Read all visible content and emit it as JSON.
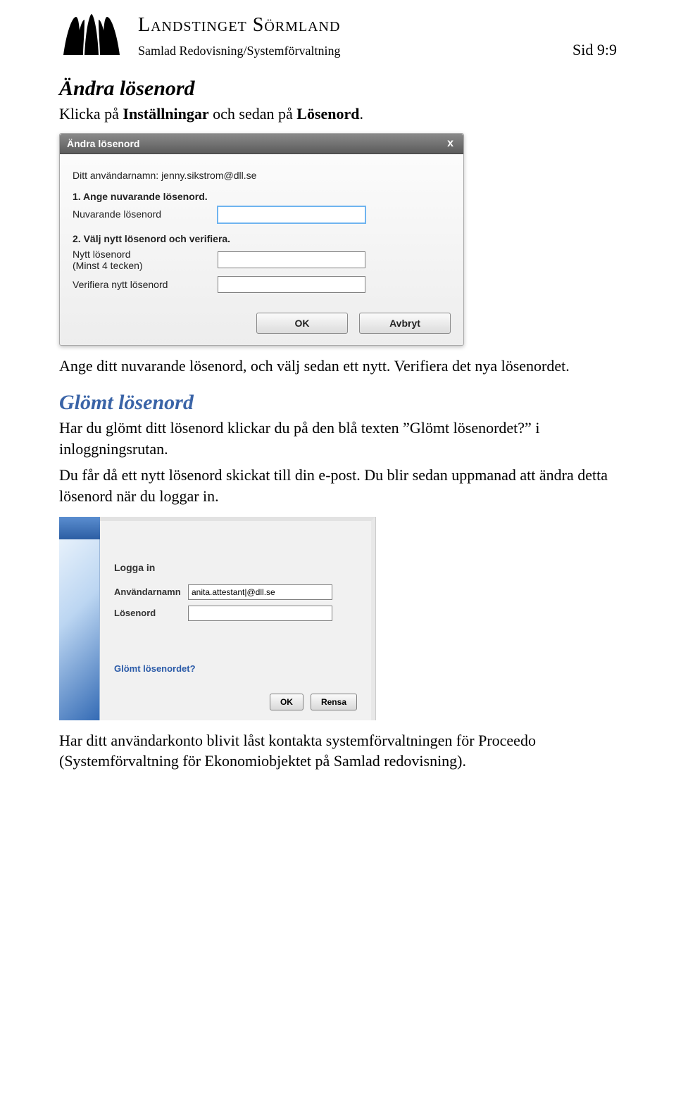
{
  "header": {
    "org_name": "Landstinget Sörmland",
    "subtitle": "Samlad Redovisning/Systemförvaltning",
    "page_indicator": "Sid 9:9"
  },
  "section1": {
    "heading": "Ändra lösenord",
    "intro_a": "Klicka på ",
    "intro_b1": "Inställningar",
    "intro_mid": " och sedan på ",
    "intro_b2": "Lösenord",
    "intro_end": "."
  },
  "dialog": {
    "title": "Ändra lösenord",
    "close": "x",
    "username_line": "Ditt användarnamn: jenny.sikstrom@dll.se",
    "step1": "1. Ange nuvarande lösenord.",
    "current_pw_label": "Nuvarande lösenord",
    "step2": "2. Välj nytt lösenord och verifiera.",
    "new_pw_label_l1": "Nytt lösenord",
    "new_pw_label_l2": "(Minst 4 tecken)",
    "verify_pw_label": "Verifiera nytt lösenord",
    "ok": "OK",
    "cancel": "Avbryt"
  },
  "after_dialog": "Ange ditt nuvarande lösenord, och välj sedan ett nytt. Verifiera det nya lösenordet.",
  "section2": {
    "heading": "Glömt lösenord",
    "p1": "Har du glömt ditt lösenord klickar du på den blå texten ”Glömt lösenordet?” i inloggningsrutan.",
    "p2": "Du får då ett nytt lösenord skickat till din e-post. Du blir sedan uppmanad att ändra detta lösenord när du loggar in."
  },
  "login": {
    "heading": "Logga in",
    "user_label": "Användarnamn",
    "user_value": "anita.attestant|@dll.se",
    "pw_label": "Lösenord",
    "forgot": "Glömt lösenordet?",
    "ok": "OK",
    "reset": "Rensa"
  },
  "final_para": "Har ditt användarkonto blivit låst kontakta systemförvaltningen för Proceedo (Systemförvaltning för Ekonomiobjektet på Samlad redovisning)."
}
